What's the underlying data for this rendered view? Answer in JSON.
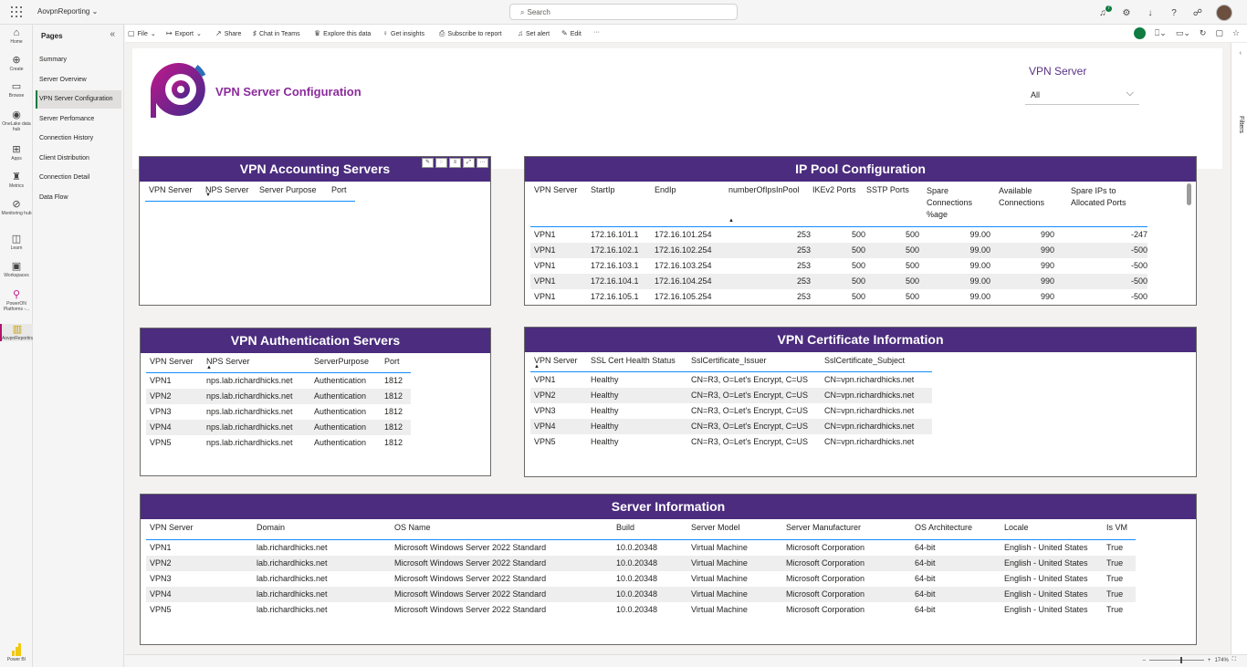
{
  "topbar": {
    "app_name": "AovpnReporting",
    "search_placeholder": "Search",
    "notif_count": "7"
  },
  "rail": {
    "items": [
      {
        "label": "Home",
        "icon": "home-icon",
        "glyph": "⌂"
      },
      {
        "label": "Create",
        "icon": "create-icon",
        "glyph": "⊕"
      },
      {
        "label": "Browse",
        "icon": "folder-icon",
        "glyph": "▭"
      },
      {
        "label": "OneLake data hub",
        "icon": "onelake-icon",
        "glyph": "◉"
      },
      {
        "label": "Apps",
        "icon": "apps-icon",
        "glyph": "⊞"
      },
      {
        "label": "Metrics",
        "icon": "metrics-icon",
        "glyph": "♜"
      },
      {
        "label": "Monitoring hub",
        "icon": "monitor-icon",
        "glyph": "⊘"
      },
      {
        "label": "Learn",
        "icon": "learn-icon",
        "glyph": "◫"
      },
      {
        "label": "Workspaces",
        "icon": "workspaces-icon",
        "glyph": "▣"
      },
      {
        "label": "PowerON Platforms -...",
        "icon": "poweron-icon",
        "glyph": "⚲"
      },
      {
        "label": "AovpnReporting",
        "icon": "report-icon",
        "glyph": "▥"
      }
    ],
    "footer_label": "Power BI"
  },
  "pages": {
    "title": "Pages",
    "items": [
      "Summary",
      "Server Overview",
      "VPN Server Configuration",
      "Server Perfomance",
      "Connection History",
      "Client Distribution",
      "Connection Detail",
      "Data Flow"
    ]
  },
  "toolbar": {
    "items": [
      "File",
      "Export",
      "Share",
      "Chat in Teams",
      "Explore this data",
      "Get insights",
      "Subscribe to report",
      "Set alert",
      "Edit",
      "···"
    ]
  },
  "filters": {
    "label": "Filters"
  },
  "header": {
    "title": "VPN Server Configuration",
    "slicer_title": "VPN Server",
    "slicer_value": "All"
  },
  "accounting": {
    "title": "VPN Accounting Servers",
    "columns": [
      "VPN Server",
      "NPS Server",
      "Server Purpose",
      "Port"
    ]
  },
  "ip_pool": {
    "title": "IP Pool Configuration",
    "columns": [
      "VPN Server",
      "StartIp",
      "EndIp",
      "numberOfIpsInPool",
      "IKEv2 Ports",
      "SSTP Ports",
      "Spare Connections %age",
      "Available Connections",
      "Spare IPs to Allocated Ports"
    ],
    "rows": [
      [
        "VPN1",
        "172.16.101.1",
        "172.16.101.254",
        "253",
        "500",
        "500",
        "99.00",
        "990",
        "-247"
      ],
      [
        "VPN1",
        "172.16.102.1",
        "172.16.102.254",
        "253",
        "500",
        "500",
        "99.00",
        "990",
        "-500"
      ],
      [
        "VPN1",
        "172.16.103.1",
        "172.16.103.254",
        "253",
        "500",
        "500",
        "99.00",
        "990",
        "-500"
      ],
      [
        "VPN1",
        "172.16.104.1",
        "172.16.104.254",
        "253",
        "500",
        "500",
        "99.00",
        "990",
        "-500"
      ],
      [
        "VPN1",
        "172.16.105.1",
        "172.16.105.254",
        "253",
        "500",
        "500",
        "99.00",
        "990",
        "-500"
      ]
    ]
  },
  "auth": {
    "title": "VPN Authentication Servers",
    "columns": [
      "VPN Server",
      "NPS Server",
      "ServerPurpose",
      "Port"
    ],
    "rows": [
      [
        "VPN1",
        "nps.lab.richardhicks.net",
        "Authentication",
        "1812"
      ],
      [
        "VPN2",
        "nps.lab.richardhicks.net",
        "Authentication",
        "1812"
      ],
      [
        "VPN3",
        "nps.lab.richardhicks.net",
        "Authentication",
        "1812"
      ],
      [
        "VPN4",
        "nps.lab.richardhicks.net",
        "Authentication",
        "1812"
      ],
      [
        "VPN5",
        "nps.lab.richardhicks.net",
        "Authentication",
        "1812"
      ]
    ]
  },
  "cert": {
    "title": "VPN Certificate Information",
    "columns": [
      "VPN Server",
      "SSL Cert Health Status",
      "SslCertificate_Issuer",
      "SslCertificate_Subject"
    ],
    "rows": [
      [
        "VPN1",
        "Healthy",
        "CN=R3, O=Let's Encrypt, C=US",
        "CN=vpn.richardhicks.net"
      ],
      [
        "VPN2",
        "Healthy",
        "CN=R3, O=Let's Encrypt, C=US",
        "CN=vpn.richardhicks.net"
      ],
      [
        "VPN3",
        "Healthy",
        "CN=R3, O=Let's Encrypt, C=US",
        "CN=vpn.richardhicks.net"
      ],
      [
        "VPN4",
        "Healthy",
        "CN=R3, O=Let's Encrypt, C=US",
        "CN=vpn.richardhicks.net"
      ],
      [
        "VPN5",
        "Healthy",
        "CN=R3, O=Let's Encrypt, C=US",
        "CN=vpn.richardhicks.net"
      ]
    ]
  },
  "server_info": {
    "title": "Server Information",
    "columns": [
      "VPN Server",
      "Domain",
      "OS Name",
      "Build",
      "Server Model",
      "Server Manufacturer",
      "OS Architecture",
      "Locale",
      "Is VM"
    ],
    "rows": [
      [
        "VPN1",
        "lab.richardhicks.net",
        "Microsoft Windows Server 2022 Standard",
        "10.0.20348",
        "Virtual Machine",
        "Microsoft Corporation",
        "64-bit",
        "English - United States",
        "True"
      ],
      [
        "VPN2",
        "lab.richardhicks.net",
        "Microsoft Windows Server 2022 Standard",
        "10.0.20348",
        "Virtual Machine",
        "Microsoft Corporation",
        "64-bit",
        "English - United States",
        "True"
      ],
      [
        "VPN3",
        "lab.richardhicks.net",
        "Microsoft Windows Server 2022 Standard",
        "10.0.20348",
        "Virtual Machine",
        "Microsoft Corporation",
        "64-bit",
        "English - United States",
        "True"
      ],
      [
        "VPN4",
        "lab.richardhicks.net",
        "Microsoft Windows Server 2022 Standard",
        "10.0.20348",
        "Virtual Machine",
        "Microsoft Corporation",
        "64-bit",
        "English - United States",
        "True"
      ],
      [
        "VPN5",
        "lab.richardhicks.net",
        "Microsoft Windows Server 2022 Standard",
        "10.0.20348",
        "Virtual Machine",
        "Microsoft Corporation",
        "64-bit",
        "English - United States",
        "True"
      ]
    ]
  },
  "status": {
    "zoom": "174%"
  },
  "colors": {
    "header_purple": "#4b2c7e",
    "title_magenta": "#8c2c9c",
    "accent_blue": "#118dff",
    "active_green": "#107c41"
  }
}
